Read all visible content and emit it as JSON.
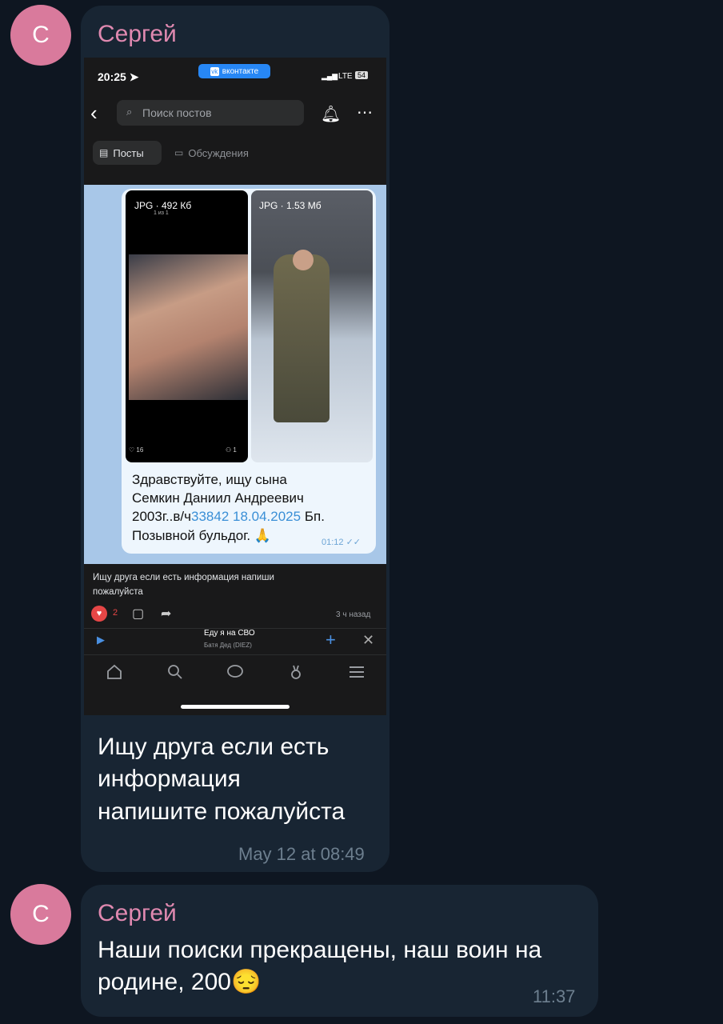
{
  "messages": [
    {
      "avatar_letter": "С",
      "sender": "Сергей",
      "text_lines": [
        "Ищу друга если есть",
        "информация",
        "напишите пожалуйста"
      ],
      "time": "May 12 at 08:49"
    },
    {
      "avatar_letter": "С",
      "sender": "Сергей",
      "text_lines": [
        "Наши поиски прекращены, наш воин на",
        "родине, 200😔"
      ],
      "time": "11:37"
    }
  ],
  "screenshot": {
    "status_time": "20:25",
    "vk_badge": "вконтакте",
    "network": "LTE",
    "battery": "54",
    "search_placeholder": "Поиск постов",
    "tab_posts": "Посты",
    "tab_discussions": "Обсуждения",
    "photo1_label": "JPG · 492 Кб",
    "photo1_sub": "1 из 1",
    "photo2_label": "JPG · 1.53 Мб",
    "photo1_likes": "16",
    "photo1_shares": "1",
    "tg_lines": [
      "Здравствуйте, ищу сына",
      "Семкин Даниил Андреевич"
    ],
    "tg_line3_pre": "2003г..в/ч",
    "tg_line3_link": "33842 18.04.2025",
    "tg_line3_post": " Бп.",
    "tg_line4": "Позывной бульдог. 🙏",
    "tg_time": "01:12",
    "caption_lines": [
      "Ищу друга если есть информация напиши",
      "пожалуйста"
    ],
    "likes": "2",
    "posted_ago": "3 ч назад",
    "player_title": "Еду я на СВО",
    "player_artist": "Батя Дед (DIEZ)"
  },
  "colors": {
    "background": "#0e1621",
    "bubble": "#182533",
    "sender": "#e089b0",
    "avatar": "#d97a9c",
    "time": "#6d7f8f",
    "vk_blue": "#2787f5"
  }
}
